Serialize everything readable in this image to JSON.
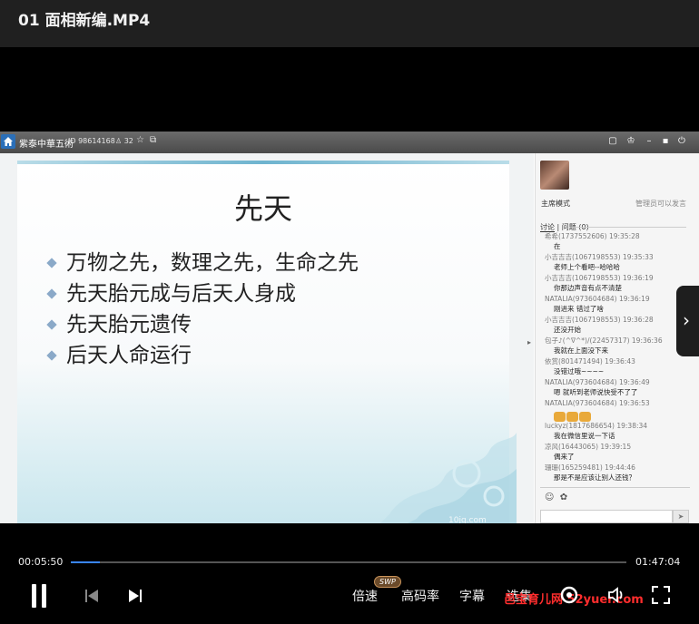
{
  "window": {
    "title": "01 面相新编.MP4"
  },
  "room": {
    "name": "紫泰中華五術",
    "id_text": "ID 98614168",
    "users_text": "32"
  },
  "slide": {
    "title": "先天",
    "bullets": [
      "万物之先，数理之先，生命之先",
      "先天胎元成与后天人身成",
      "先天胎元遗传",
      "后天人命运行"
    ],
    "watermark": "10jq.com"
  },
  "chat": {
    "mode": "主席模式",
    "admin_note": "管理员可以发言",
    "tab_discussion": "讨论",
    "tab_question": "问题 (0)",
    "messages": [
      {
        "head": "希希(1737552606) 19:35:28",
        "body": "在"
      },
      {
        "head": "小吉吉吉(1067198553) 19:35:33",
        "body": "老师上个看吧--哈哈哈"
      },
      {
        "head": "小吉吉吉(1067198553) 19:36:19",
        "body": "你那边声音有点不清楚"
      },
      {
        "head": "NATALIA(973604684) 19:36:19",
        "body": "刚进来 错过了啥"
      },
      {
        "head": "小吉吉吉(1067198553) 19:36:28",
        "body": "还没开始"
      },
      {
        "head": "包子♪(^∇^*)/(22457317) 19:36:36",
        "body": "我就在上面没下来"
      },
      {
        "head": "依赏(801471494) 19:36:43",
        "body": "没错过哦~~~~"
      },
      {
        "head": "NATALIA(973604684) 19:36:49",
        "body": "嗯 就听到老师说快受不了了"
      },
      {
        "head": "NATALIA(973604684) 19:36:53",
        "body": ""
      },
      {
        "head": "luckyz(1817686654) 19:38:34",
        "body": "我在微信里说一下话"
      },
      {
        "head": "凉风(16443065) 19:39:15",
        "body": "偶来了"
      },
      {
        "head": "珊珊(165259481) 19:44:46",
        "body": "那是不是应该让别人还钱？"
      }
    ]
  },
  "player": {
    "current_time": "00:05:50",
    "total_time": "01:47:04",
    "progress": 0.053,
    "speed_label": "倍速",
    "swp_badge": "SWP",
    "bitrate_label": "高码率",
    "subtitle_label": "字幕",
    "episodes_label": "选集",
    "watermark": "邑宝育儿网 52yuer.com"
  },
  "colors": {
    "progress": "#3a86ff",
    "watermark": "#ff2d2d",
    "room_home": "#2b6fb8"
  }
}
